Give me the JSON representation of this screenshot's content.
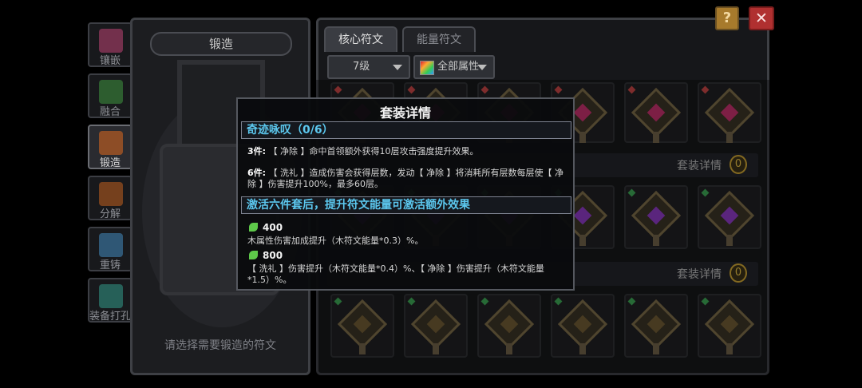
{
  "side_nav": [
    {
      "label": "镶嵌",
      "icon": "inlay-icon",
      "active": false
    },
    {
      "label": "融合",
      "icon": "fusion-icon",
      "active": false
    },
    {
      "label": "锻造",
      "icon": "forge-icon",
      "active": true
    },
    {
      "label": "分解",
      "icon": "decompose-icon",
      "active": false
    },
    {
      "label": "重铸",
      "icon": "recast-icon",
      "active": false
    },
    {
      "label": "装备打孔",
      "icon": "socket-icon",
      "active": false
    }
  ],
  "forge": {
    "title": "锻造",
    "hint": "请选择需要锻造的符文"
  },
  "tabs": {
    "core": "核心符文",
    "energy": "能量符文"
  },
  "filters": {
    "level": "7级",
    "attribute": "全部属性"
  },
  "set_rows": [
    {
      "label": "套装详情",
      "badge": "0"
    },
    {
      "label": "套装详情",
      "badge": "0"
    }
  ],
  "buttons": {
    "help": "?",
    "close": "✕"
  },
  "colors": {
    "accent_cyan": "#5cc8ef",
    "badge_gold": "#c9a233",
    "leaf_green": "#5ec94a"
  },
  "popup": {
    "title": "套装详情",
    "set_name": "奇迹咏叹（0/6）",
    "bonus_3_key": "3件:",
    "bonus_3_text": "【 净除 】命中首领额外获得10层攻击强度提升效果。",
    "bonus_6_key": "6件:",
    "bonus_6_text": "【 洗礼 】造成伤害会获得层数，发动【 净除 】将消耗所有层数每层使【 净除 】伤害提升100%，最多60层。",
    "extra_header": "激活六件套后，提升符文能量可激活额外效果",
    "energy_tiers": [
      {
        "value": "400",
        "text": "木属性伤害加成提升（木符文能量*0.3）%。"
      },
      {
        "value": "800",
        "text": "【 洗礼 】伤害提升（木符文能量*0.4）%、【 净除 】伤害提升（木符文能量*1.5）%。"
      }
    ]
  }
}
